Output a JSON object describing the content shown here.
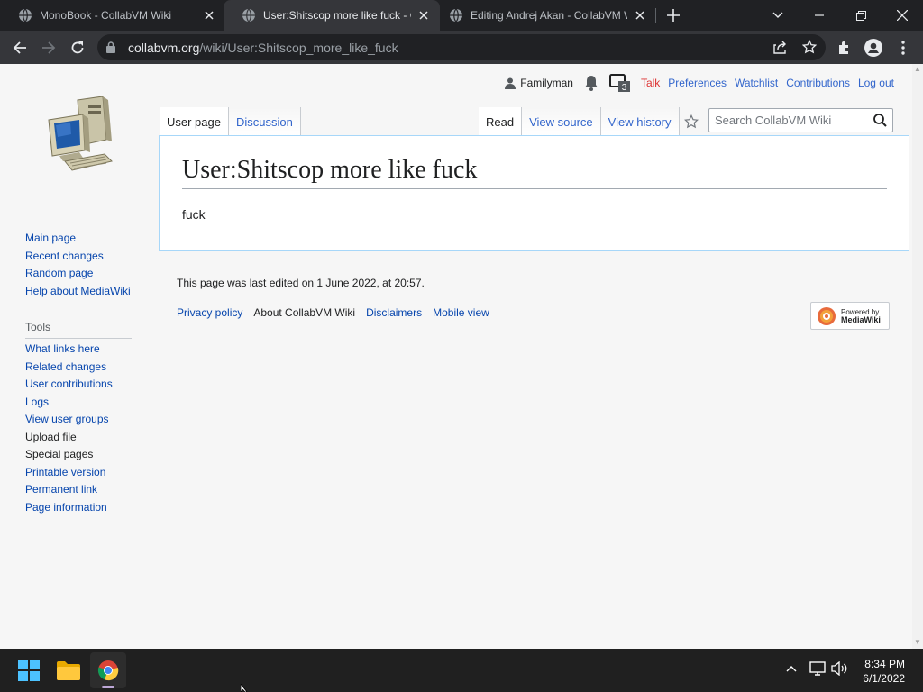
{
  "browser": {
    "tabs": [
      {
        "title": "MonoBook - CollabVM Wiki",
        "active": false
      },
      {
        "title": "User:Shitscop more like fuck - CollabVM Wiki",
        "active": true
      },
      {
        "title": "Editing Andrej Akan - CollabVM Wiki",
        "active": false
      }
    ],
    "url_host": "collabvm.org",
    "url_path": "/wiki/User:Shitscop_more_like_fuck"
  },
  "personal": {
    "username": "Familyman",
    "notice_count": "3",
    "talk": "Talk",
    "preferences": "Preferences",
    "watchlist": "Watchlist",
    "contributions": "Contributions",
    "logout": "Log out"
  },
  "tabs": {
    "user_page": "User page",
    "discussion": "Discussion",
    "read": "Read",
    "view_source": "View source",
    "view_history": "View history"
  },
  "search": {
    "placeholder": "Search CollabVM Wiki"
  },
  "content": {
    "title": "User:Shitscop more like fuck",
    "body": "fuck"
  },
  "navigation": {
    "items": [
      "Main page",
      "Recent changes",
      "Random page",
      "Help about MediaWiki"
    ]
  },
  "tools": {
    "heading": "Tools",
    "items": [
      "What links here",
      "Related changes",
      "User contributions",
      "Logs",
      "View user groups",
      "Upload file",
      "Special pages",
      "Printable version",
      "Permanent link",
      "Page information"
    ]
  },
  "footer": {
    "last_edited": "This page was last edited on 1 June 2022, at 20:57.",
    "links": [
      "Privacy policy",
      "About CollabVM Wiki",
      "Disclaimers",
      "Mobile view"
    ],
    "powered_line1": "Powered by",
    "powered_line2": "MediaWiki"
  },
  "taskbar": {
    "time": "8:34 PM",
    "date": "6/1/2022"
  }
}
